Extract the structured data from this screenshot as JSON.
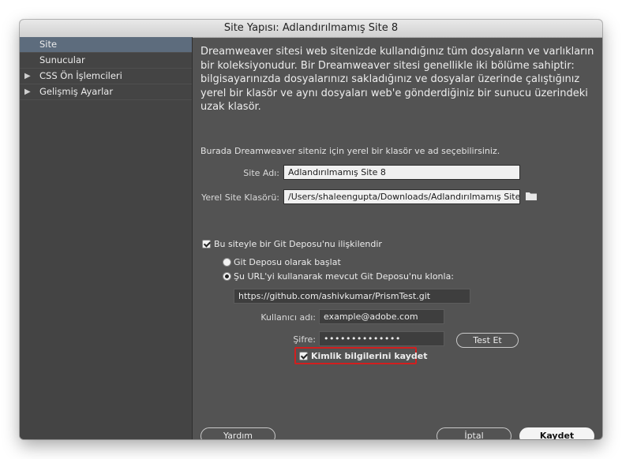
{
  "window": {
    "title": "Site Yapısı: Adlandırılmamış Site 8"
  },
  "sidebar": {
    "items": [
      {
        "label": "Site",
        "selected": true,
        "expandable": false
      },
      {
        "label": "Sunucular",
        "selected": false,
        "expandable": false
      },
      {
        "label": "CSS Ön İşlemcileri",
        "selected": false,
        "expandable": true
      },
      {
        "label": "Gelişmiş Ayarlar",
        "selected": false,
        "expandable": true
      }
    ]
  },
  "content": {
    "intro": "Dreamweaver sitesi web sitenizde kullandığınız tüm dosyaların ve varlıkların bir koleksiyonudur. Bir Dreamweaver sitesi genellikle iki bölüme sahiptir: bilgisayarınızda dosyalarınızı sakladığınız ve dosyalar üzerinde çalıştığınız yerel bir klasör ve aynı dosyaları web'e gönderdiğiniz bir sunucu üzerindeki uzak klasör.",
    "subtext": "Burada Dreamweaver siteniz için yerel bir klasör ve ad seçebilirsiniz.",
    "site_name_label": "Site Adı:",
    "site_name_value": "Adlandırılmamış Site 8",
    "local_folder_label": "Yerel Site Klasörü:",
    "local_folder_value": "/Users/shaleengupta/Downloads/Adlandırılmamış Site",
    "git_checkbox_label": "Bu siteyle bir Git Deposu'nu ilişkilendir",
    "git_checked": true,
    "radio_init_label": "Git Deposu olarak başlat",
    "radio_clone_label": "Şu URL'yi kullanarak mevcut Git Deposu'nu klonla:",
    "radio_selected": "clone",
    "clone_url": "https://github.com/ashivkumar/PrismTest.git",
    "username_label": "Kullanıcı adı:",
    "username_value": "example@adobe.com",
    "password_label": "Şifre:",
    "password_value": "••••••••••••••",
    "test_button": "Test Et",
    "save_credentials_label": "Kimlik bilgilerini kaydet",
    "save_credentials_checked": true
  },
  "footer": {
    "help": "Yardım",
    "cancel": "İptal",
    "save": "Kaydet"
  },
  "colors": {
    "highlight": "#d21e1e",
    "selected_sidebar": "#5d6c7d",
    "panel": "#535353"
  }
}
